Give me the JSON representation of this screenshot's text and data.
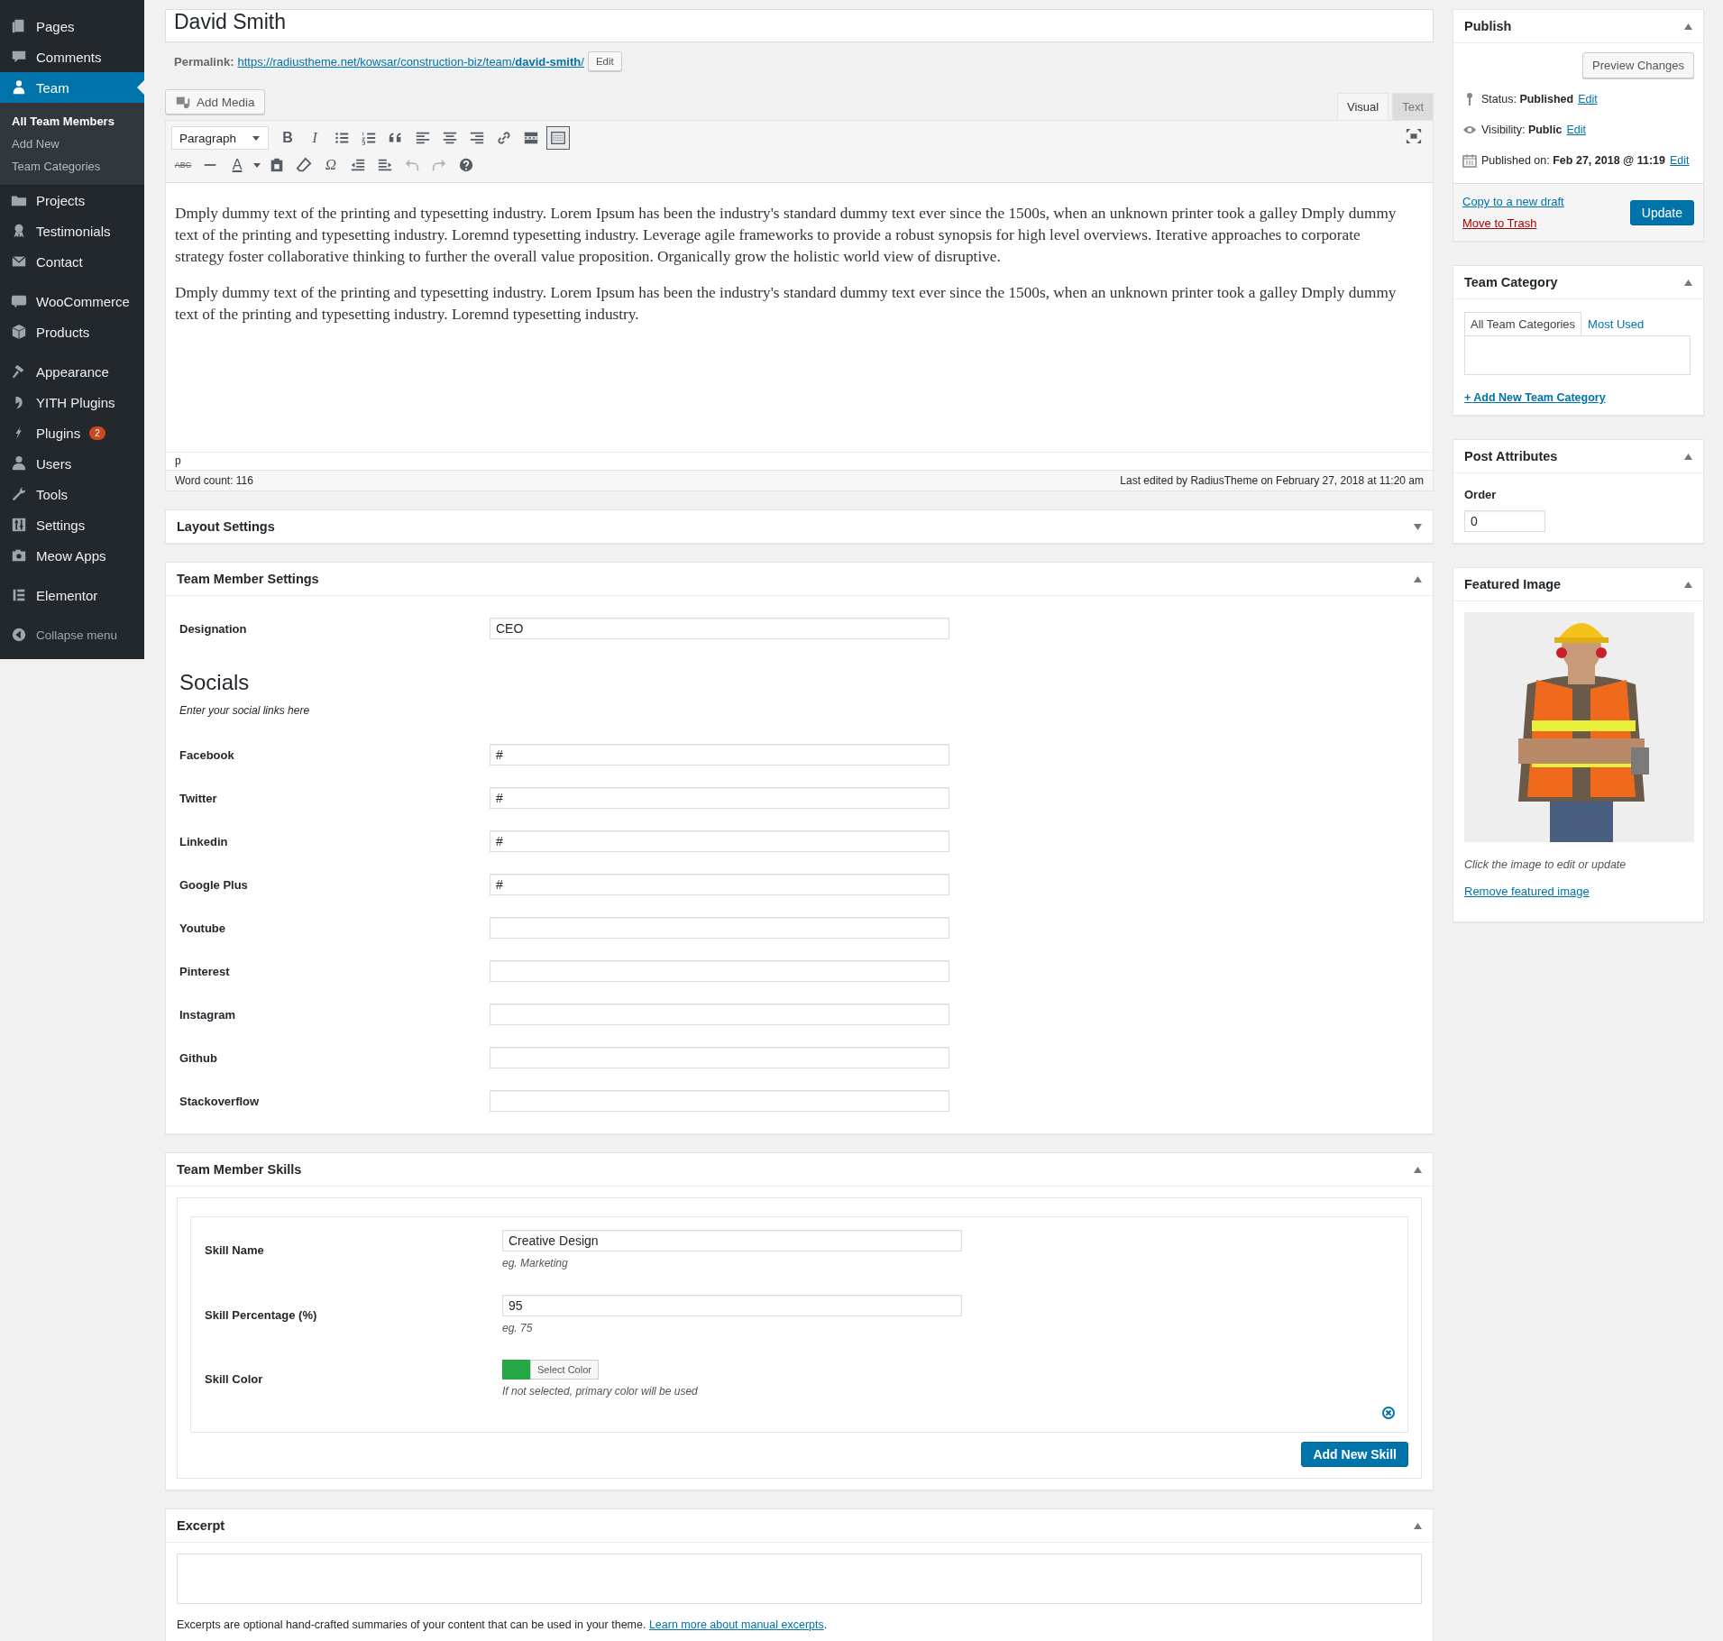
{
  "sidebar": {
    "groups": [
      [
        {
          "label": "Pages",
          "selected": false
        },
        {
          "label": "Comments",
          "selected": false
        },
        {
          "label": "Team",
          "selected": true,
          "children": [
            {
              "label": "All Team Members",
              "selected": true
            },
            {
              "label": "Add New",
              "selected": false
            },
            {
              "label": "Team Categories",
              "selected": false
            }
          ]
        },
        {
          "label": "Projects",
          "selected": false
        },
        {
          "label": "Testimonials",
          "selected": false
        },
        {
          "label": "Contact",
          "selected": false
        }
      ],
      [
        {
          "label": "WooCommerce",
          "selected": false
        },
        {
          "label": "Products",
          "selected": false
        }
      ],
      [
        {
          "label": "Appearance",
          "selected": false
        },
        {
          "label": "YITH Plugins",
          "selected": false
        },
        {
          "label": "Plugins",
          "selected": false,
          "badge": "2"
        },
        {
          "label": "Users",
          "selected": false
        },
        {
          "label": "Tools",
          "selected": false
        },
        {
          "label": "Settings",
          "selected": false
        },
        {
          "label": "Meow Apps",
          "selected": false
        }
      ],
      [
        {
          "label": "Elementor",
          "selected": false
        }
      ]
    ],
    "collapse": "Collapse menu"
  },
  "title": "David Smith",
  "permalink": {
    "label": "Permalink:",
    "url": "https://radiustheme.net/kowsar/construction-biz/team/**david-smith**/",
    "edit": "Edit"
  },
  "add_media": "Add Media",
  "editor_tabs": [
    {
      "label": "Visual",
      "selected": true
    },
    {
      "label": "Text",
      "selected": false
    }
  ],
  "toolbar": {
    "rows": [
      [
        {
          "kind": "select",
          "text": "Paragraph"
        },
        {
          "kind": "glyph",
          "text": "B",
          "pressed": false
        },
        {
          "kind": "glyph",
          "text": "I",
          "pressed": false
        },
        {
          "kind": "icon",
          "pressed": false
        },
        {
          "kind": "icon",
          "pressed": false
        },
        {
          "kind": "icon",
          "pressed": false
        },
        {
          "kind": "icon",
          "pressed": false
        },
        {
          "kind": "icon",
          "pressed": false
        },
        {
          "kind": "icon",
          "pressed": false
        },
        {
          "kind": "icon",
          "pressed": false
        },
        {
          "kind": "icon",
          "pressed": false
        },
        {
          "kind": "icon",
          "pressed": true
        }
      ],
      [
        {
          "kind": "glyph",
          "text": "ABC",
          "pressed": false
        },
        {
          "kind": "icon",
          "pressed": false
        },
        {
          "kind": "color",
          "text": "A",
          "pressed": false
        },
        {
          "kind": "icon",
          "pressed": false
        },
        {
          "kind": "icon",
          "pressed": false
        },
        {
          "kind": "glyph",
          "text": "Ω",
          "pressed": false
        },
        {
          "kind": "icon",
          "pressed": false
        },
        {
          "kind": "icon",
          "pressed": false
        },
        {
          "kind": "icon",
          "pressed": false
        },
        {
          "kind": "icon",
          "pressed": false
        },
        {
          "kind": "icon",
          "pressed": false
        }
      ]
    ]
  },
  "content": [
    "Dmply dummy text of the printing and typesetting industry. Lorem Ipsum has been the industry's standard dummy text ever since the 1500s, when an unknown printer took a galley Dmply dummy text of the printing and typesetting industry. Loremnd typesetting industry. Leverage agile frameworks to provide a robust synopsis for high level overviews. Iterative approaches to corporate strategy foster collaborative thinking to further the overall value proposition. Organically grow the holistic world view of disruptive.",
    "Dmply dummy text of the printing and typesetting industry. Lorem Ipsum has been the industry's standard dummy text ever since the 1500s, when an unknown printer took a galley Dmply dummy text of the printing and typesetting industry. Loremnd typesetting industry."
  ],
  "status": {
    "path": "p",
    "word_count": "Word count: 116",
    "last_edited": "Last edited by RadiusTheme on February 27, 2018 at 11:20 am"
  },
  "layout_settings": {
    "title": "Layout Settings",
    "expanded": false
  },
  "member_settings": {
    "title": "Team Member Settings",
    "expanded": true,
    "fields": [
      {
        "label": "Designation",
        "value": "CEO"
      }
    ],
    "socials": {
      "heading": "Socials",
      "description": "Enter your social links here",
      "fields": [
        {
          "label": "Facebook",
          "value": "#"
        },
        {
          "label": "Twitter",
          "value": "#"
        },
        {
          "label": "Linkedin",
          "value": "#"
        },
        {
          "label": "Google Plus",
          "value": "#"
        },
        {
          "label": "Youtube"
        },
        {
          "label": "Pinterest"
        },
        {
          "label": "Instagram"
        },
        {
          "label": "Github"
        },
        {
          "label": "Stackoverflow"
        }
      ]
    }
  },
  "skills": {
    "title": "Team Member Skills",
    "expanded": true,
    "name": {
      "label": "Skill Name",
      "value": "Creative Design",
      "hint": "eg. Marketing"
    },
    "percentage": {
      "label": "Skill Percentage (%)",
      "value": "95",
      "hint": "eg. 75"
    },
    "color": {
      "label": "Skill Color",
      "color": "#27a844",
      "button": "Select Color",
      "hint": "If not selected, primary color will be used"
    },
    "add_button": "Add New Skill"
  },
  "excerpt": {
    "title": "Excerpt",
    "expanded": true,
    "help": "Excerpts are optional hand-crafted summaries of your content that can be used in your theme. ",
    "link": "Learn more about manual excerpts",
    "after": "."
  },
  "publish": {
    "title": "Publish",
    "expanded": true,
    "preview": "Preview Changes",
    "rows": [
      {
        "text": "Status: **Published**",
        "link": "Edit"
      },
      {
        "text": "Visibility: **Public**",
        "link": "Edit"
      },
      {
        "text": "Published on: **Feb 27, 2018 @ 11:19**",
        "link": "Edit"
      }
    ],
    "copy": "Copy to a new draft",
    "trash": "Move to Trash",
    "update": "Update"
  },
  "team_category": {
    "title": "Team Category",
    "expanded": true,
    "tabs": [
      {
        "label": "All Team Categories",
        "selected": true
      },
      {
        "label": "Most Used",
        "selected": false
      }
    ],
    "add": "+ Add New Team Category"
  },
  "post_attributes": {
    "title": "Post Attributes",
    "expanded": true,
    "order_label": "Order",
    "order_value": "0"
  },
  "featured_image": {
    "title": "Featured Image",
    "expanded": true,
    "hint": "Click the image to edit or update",
    "remove": "Remove featured image"
  }
}
